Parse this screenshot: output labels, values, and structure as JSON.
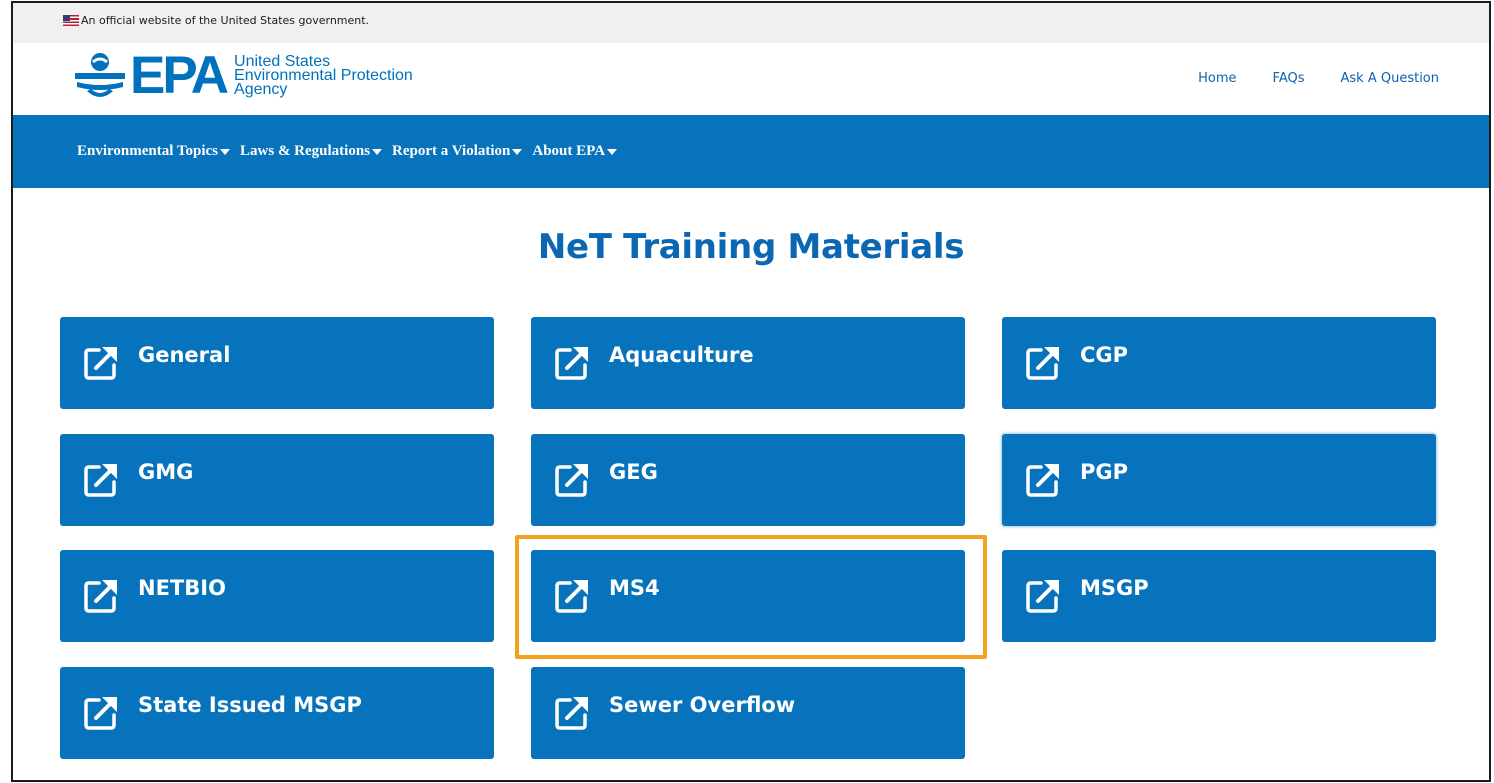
{
  "gov_banner": {
    "text": "An official website of the United States government."
  },
  "header": {
    "logo": {
      "acronym": "EPA",
      "line1": "United States",
      "line2": "Environmental Protection",
      "line3": "Agency"
    },
    "util_links": [
      "Home",
      "FAQs",
      "Ask A Question"
    ]
  },
  "nav": {
    "items": [
      "Environmental Topics",
      "Laws & Regulations",
      "Report a Violation",
      "About EPA"
    ]
  },
  "page_title": "NeT Training Materials",
  "tiles": [
    {
      "label": "General",
      "icon": "external-link-icon"
    },
    {
      "label": "Aquaculture",
      "icon": "external-link-icon"
    },
    {
      "label": "CGP",
      "icon": "external-link-icon"
    },
    {
      "label": "GMG",
      "icon": "external-link-icon"
    },
    {
      "label": "GEG",
      "icon": "external-link-icon"
    },
    {
      "label": "PGP",
      "icon": "external-link-icon"
    },
    {
      "label": "NETBIO",
      "icon": "external-link-icon"
    },
    {
      "label": "MS4",
      "icon": "external-link-icon",
      "highlighted": true
    },
    {
      "label": "MSGP",
      "icon": "external-link-icon"
    },
    {
      "label": "State Issued MSGP",
      "icon": "external-link-icon"
    },
    {
      "label": "Sewer Overflow",
      "icon": "external-link-icon"
    }
  ],
  "colors": {
    "brand_blue": "#0873bd",
    "title_blue": "#0b66b3",
    "highlight": "#f4a21e"
  }
}
